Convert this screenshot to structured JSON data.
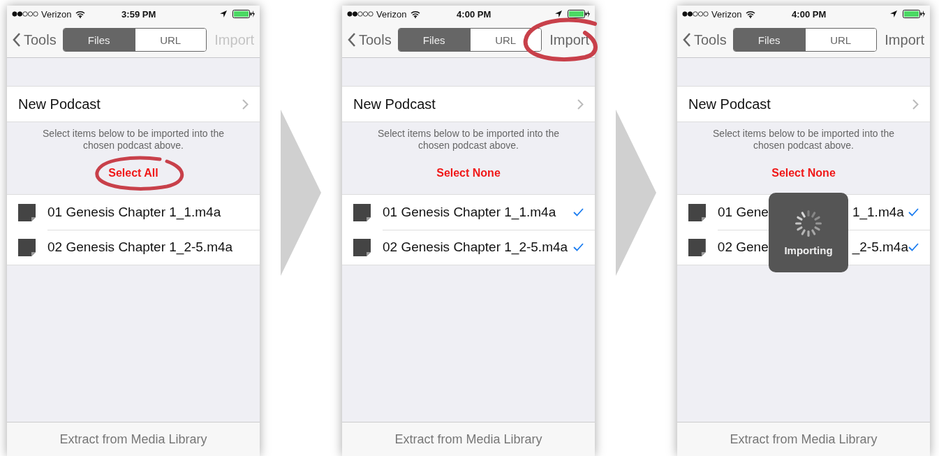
{
  "screens": [
    {
      "status": {
        "carrier": "Verizon",
        "time": "3:59 PM"
      },
      "nav": {
        "back": "Tools",
        "segments": [
          {
            "label": "Files",
            "selected": true
          },
          {
            "label": "URL",
            "selected": false
          }
        ],
        "action": {
          "label": "Import",
          "disabled": true,
          "circled": false
        }
      },
      "podcast": "New Podcast",
      "note": "Select items below to be imported into the chosen podcast above.",
      "select_toggle": {
        "label": "Select All",
        "circled": true
      },
      "files": [
        {
          "name_parts": [
            "01 Genesis Chapter 1_1.m4a"
          ],
          "checked": false
        },
        {
          "name_parts": [
            "02 Genesis Chapter 1_2-5.m4a"
          ],
          "checked": false
        }
      ],
      "footer": "Extract from Media Library"
    },
    {
      "status": {
        "carrier": "Verizon",
        "time": "4:00 PM"
      },
      "nav": {
        "back": "Tools",
        "segments": [
          {
            "label": "Files",
            "selected": true
          },
          {
            "label": "URL",
            "selected": false
          }
        ],
        "action": {
          "label": "Import",
          "disabled": false,
          "circled": true
        }
      },
      "podcast": "New Podcast",
      "note": "Select items below to be imported into the chosen podcast above.",
      "select_toggle": {
        "label": "Select None",
        "circled": false
      },
      "files": [
        {
          "name_parts": [
            "01 Genesis Chapter 1_1.m4a"
          ],
          "checked": true
        },
        {
          "name_parts": [
            "02 Genesis Chapter 1_2-5.m4a"
          ],
          "checked": true
        }
      ],
      "footer": "Extract from Media Library"
    },
    {
      "status": {
        "carrier": "Verizon",
        "time": "4:00 PM"
      },
      "nav": {
        "back": "Tools",
        "segments": [
          {
            "label": "Files",
            "selected": true
          },
          {
            "label": "URL",
            "selected": false
          }
        ],
        "action": {
          "label": "Import",
          "disabled": false,
          "circled": false
        }
      },
      "podcast": "New Podcast",
      "note": "Select items below to be imported into the chosen podcast above.",
      "select_toggle": {
        "label": "Select None",
        "circled": false
      },
      "files": [
        {
          "name_parts": [
            "01 Gene",
            "1_1.m4a"
          ],
          "checked": true
        },
        {
          "name_parts": [
            "02 Gene",
            "_2-5.m4a"
          ],
          "checked": true
        }
      ],
      "footer": "Extract from Media Library",
      "hud": {
        "label": "Importing"
      }
    }
  ]
}
